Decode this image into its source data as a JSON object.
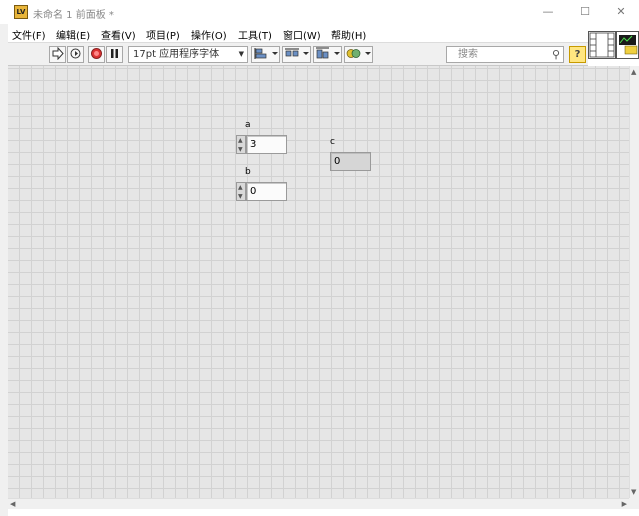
{
  "window": {
    "title": "未命名 1 前面板 *",
    "app_icon_text": "LV",
    "controls": {
      "minimize": "—",
      "maximize": "☐",
      "close": "✕"
    }
  },
  "menu": {
    "items": [
      "文件(F)",
      "编辑(E)",
      "查看(V)",
      "项目(P)",
      "操作(O)",
      "工具(T)",
      "窗口(W)",
      "帮助(H)"
    ]
  },
  "toolbar": {
    "font": "17pt 应用程序字体",
    "search_placeholder": "搜索",
    "help": "?"
  },
  "panel": {
    "control_a": {
      "label": "a",
      "value": "3"
    },
    "control_b": {
      "label": "b",
      "value": "0"
    },
    "indicator_c": {
      "label": "c",
      "value": "0"
    }
  }
}
